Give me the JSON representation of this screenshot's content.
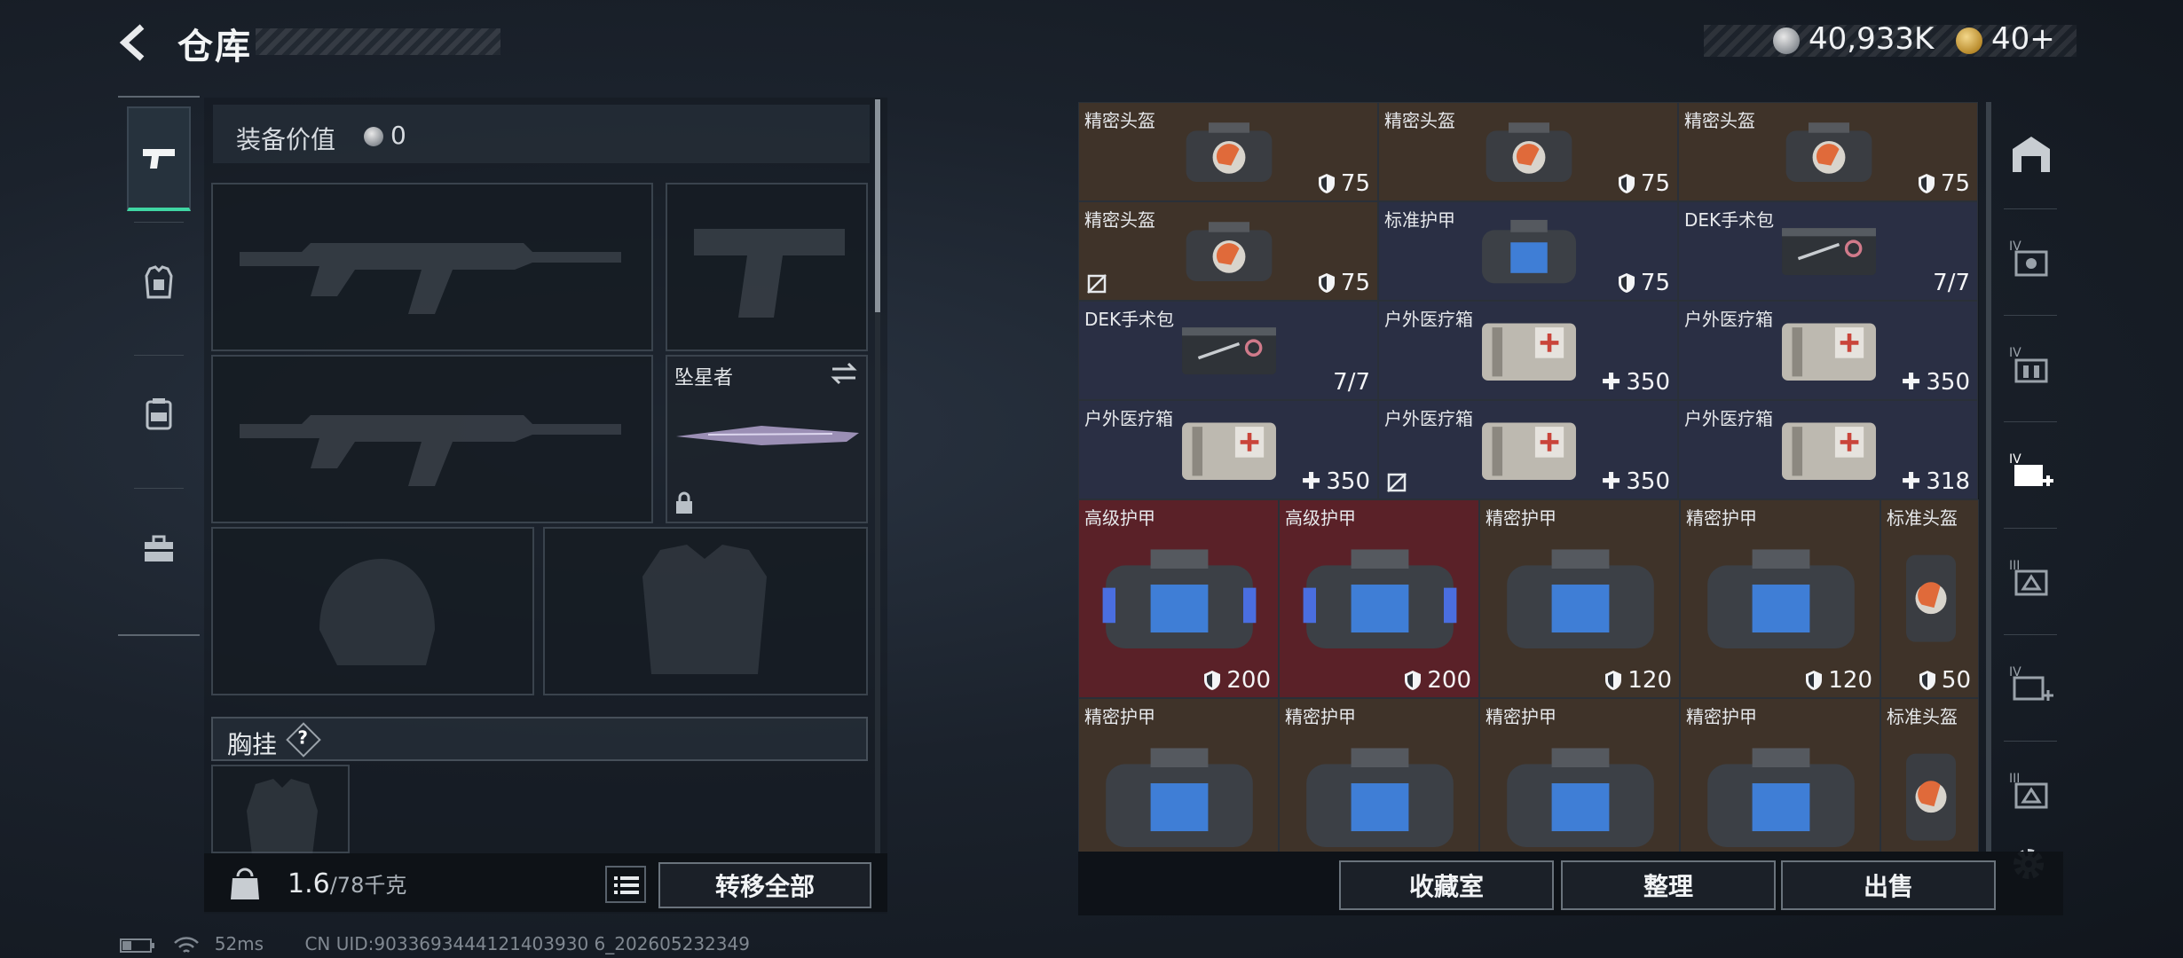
{
  "header": {
    "title": "仓库",
    "currency_primary": "40,933K",
    "currency_secondary": "40+"
  },
  "equipment": {
    "value_label": "装备价值",
    "value": "0",
    "melee_name": "坠星者",
    "chest_label": "胸挂",
    "chest_help": "?",
    "weight": "1.6",
    "weight_max": "/78千克",
    "transfer_all": "转移全部"
  },
  "inventory": {
    "rows": [
      [
        {
          "name": "精密头盔",
          "value": "75",
          "kind": "shield",
          "bg": "brown",
          "item": "helmet"
        },
        {
          "name": "精密头盔",
          "value": "75",
          "kind": "shield",
          "bg": "brown",
          "item": "helmet"
        },
        {
          "name": "精密头盔",
          "value": "75",
          "kind": "shield",
          "bg": "brown",
          "item": "helmet"
        }
      ],
      [
        {
          "name": "精密头盔",
          "value": "75",
          "kind": "shield",
          "bg": "brown",
          "item": "helmet",
          "no_insure": true
        },
        {
          "name": "标准护甲",
          "value": "75",
          "kind": "shield",
          "bg": "blue",
          "item": "armor-small"
        },
        {
          "name": "DEK手术包",
          "value": "7/7",
          "kind": "plain",
          "bg": "blue",
          "item": "surgery"
        }
      ],
      [
        {
          "name": "DEK手术包",
          "value": "7/7",
          "kind": "plain",
          "bg": "blue",
          "item": "surgery"
        },
        {
          "name": "户外医疗箱",
          "value": "350",
          "kind": "plus",
          "bg": "blue",
          "item": "medkit"
        },
        {
          "name": "户外医疗箱",
          "value": "350",
          "kind": "plus",
          "bg": "blue",
          "item": "medkit"
        }
      ],
      [
        {
          "name": "户外医疗箱",
          "value": "350",
          "kind": "plus",
          "bg": "blue",
          "item": "medkit"
        },
        {
          "name": "户外医疗箱",
          "value": "350",
          "kind": "plus",
          "bg": "blue",
          "item": "medkit",
          "no_insure": true
        },
        {
          "name": "户外医疗箱",
          "value": "318",
          "kind": "plus",
          "bg": "blue",
          "item": "medkit"
        }
      ]
    ],
    "big_rows": [
      [
        {
          "name": "高级护甲",
          "value": "200",
          "bg": "red",
          "item": "armor-blue"
        },
        {
          "name": "高级护甲",
          "value": "200",
          "bg": "red",
          "item": "armor-blue"
        },
        {
          "name": "精密护甲",
          "value": "120",
          "bg": "brown",
          "item": "armor"
        },
        {
          "name": "精密护甲",
          "value": "120",
          "bg": "brown",
          "item": "armor"
        },
        {
          "name": "标准头盔",
          "value": "50",
          "bg": "brown",
          "item": "helmet-narrow"
        }
      ],
      [
        {
          "name": "精密护甲",
          "value": "",
          "bg": "brown",
          "item": "armor"
        },
        {
          "name": "精密护甲",
          "value": "",
          "bg": "brown",
          "item": "armor"
        },
        {
          "name": "精密护甲",
          "value": "",
          "bg": "brown",
          "item": "armor"
        },
        {
          "name": "精密护甲",
          "value": "",
          "bg": "brown",
          "item": "armor"
        },
        {
          "name": "标准头盔",
          "value": "",
          "bg": "brown",
          "item": "helmet-narrow"
        }
      ]
    ]
  },
  "actions": {
    "collection": "收藏室",
    "organize": "整理",
    "sell": "出售"
  },
  "status": {
    "ping": "52ms",
    "uid": "CN UID:9033693444121403930 6_202605232349"
  }
}
